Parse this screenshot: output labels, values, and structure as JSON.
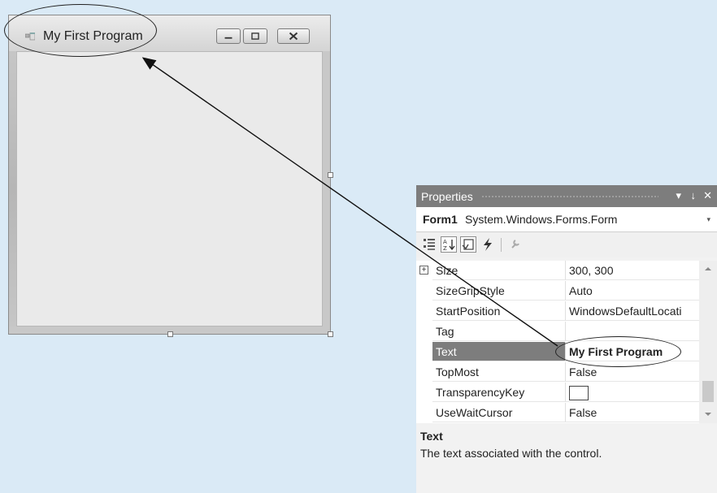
{
  "form_window": {
    "title": "My First Program"
  },
  "properties_panel": {
    "title": "Properties",
    "pin_glyph": "↓",
    "close_glyph": "✕",
    "dropdown_glyph": "▾",
    "object_name": "Form1",
    "object_type": "System.Windows.Forms.Form",
    "toolbar_icons": [
      "categorized-icon",
      "alphabetical-icon",
      "properties-icon",
      "events-icon",
      "property-pages-icon"
    ],
    "rows": [
      {
        "name": "Size",
        "value": "300, 300",
        "expandable": true
      },
      {
        "name": "SizeGripStyle",
        "value": "Auto"
      },
      {
        "name": "StartPosition",
        "value": "WindowsDefaultLocati"
      },
      {
        "name": "Tag",
        "value": ""
      },
      {
        "name": "Text",
        "value": "My First Program",
        "selected": true
      },
      {
        "name": "TopMost",
        "value": "False"
      },
      {
        "name": "TransparencyKey",
        "value": "",
        "color_swatch": true
      },
      {
        "name": "UseWaitCursor",
        "value": "False"
      }
    ],
    "description_title": "Text",
    "description_text": "The text associated with the control."
  },
  "colors": {
    "background": "#daeaf6",
    "panel_header": "#7d7d7d",
    "selected_row": "#7d7d7d"
  }
}
